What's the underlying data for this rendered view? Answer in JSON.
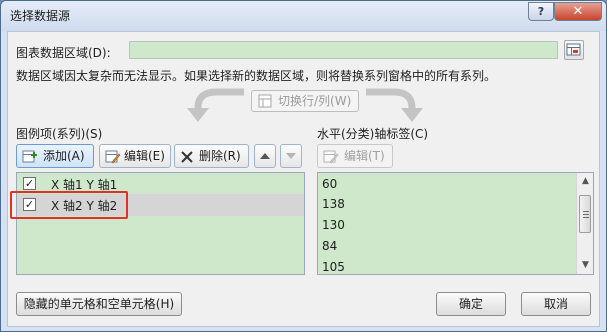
{
  "window": {
    "title": "选择数据源"
  },
  "titlebar": {
    "help_label": "?",
    "close_label": "✕"
  },
  "range": {
    "label": "图表数据区域(D):",
    "value": ""
  },
  "warning": "数据区域因太复杂而无法显示。如果选择新的数据区域，则将替换系列窗格中的所有系列。",
  "swap_button": "切换行/列(W)",
  "legend": {
    "header": "图例项(系列)(S)",
    "add_label": "添加(A)",
    "edit_label": "编辑(E)",
    "delete_label": "删除(R)",
    "series": [
      {
        "label": "X 轴1  Y 轴1",
        "checked": true,
        "selected": false
      },
      {
        "label": "X 轴2  Y 轴2",
        "checked": true,
        "selected": true
      }
    ]
  },
  "axis": {
    "header": "水平(分类)轴标签(C)",
    "edit_label": "编辑(T)",
    "items": [
      "60",
      "138",
      "130",
      "84",
      "105"
    ]
  },
  "footer": {
    "hidden_cells_label": "隐藏的单元格和空单元格(H)",
    "ok_label": "确定",
    "cancel_label": "取消"
  }
}
